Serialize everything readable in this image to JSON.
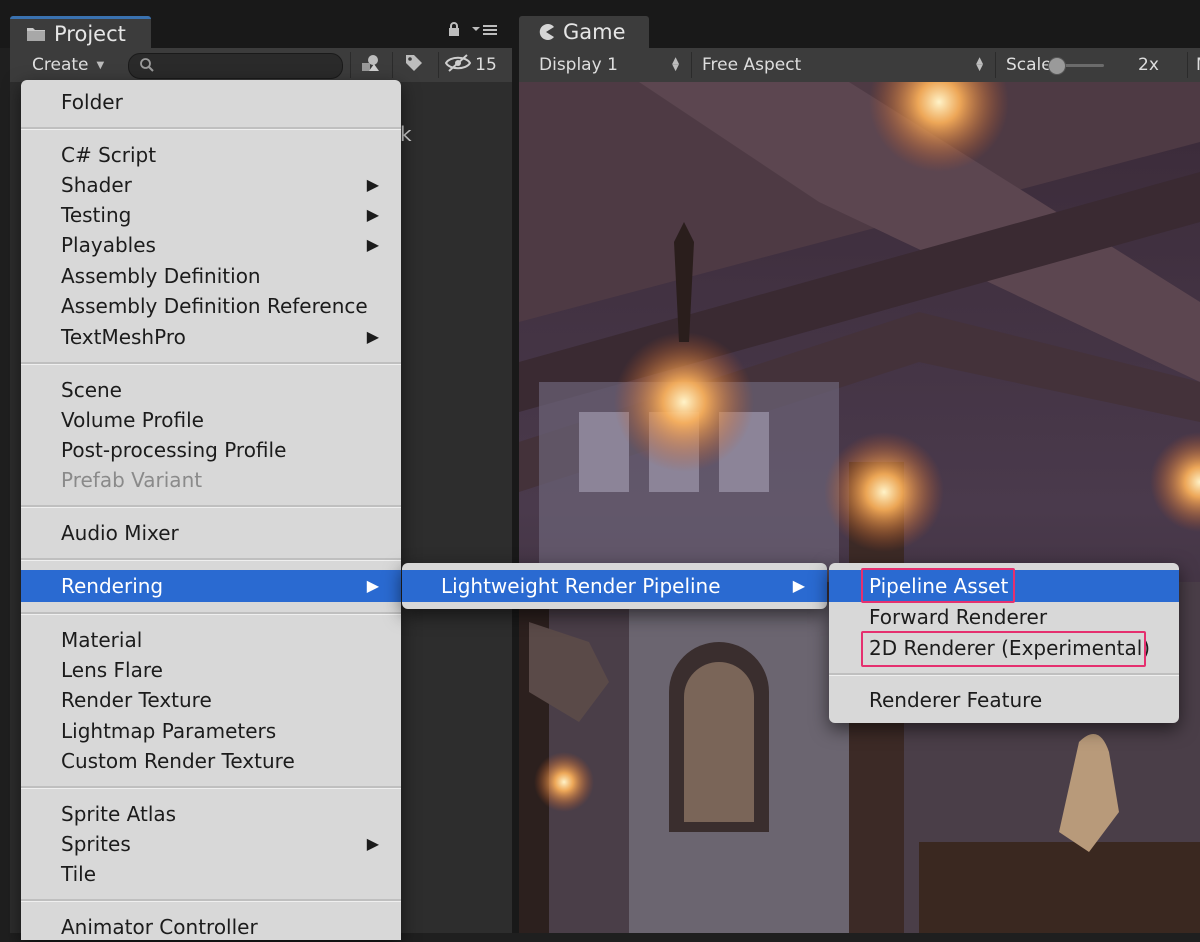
{
  "tabs": {
    "project": "Project",
    "game": "Game"
  },
  "project_toolbar": {
    "create_label": "Create",
    "search_placeholder": "",
    "hidden_count": "15"
  },
  "project_body": {
    "stray_text": "k"
  },
  "game_toolbar": {
    "display": "Display 1",
    "aspect": "Free Aspect",
    "scale_label": "Scale",
    "scale_value": "2x",
    "cut_label": "M"
  },
  "menu_main": {
    "items": [
      {
        "label": "Folder"
      },
      {
        "label": "C# Script"
      },
      {
        "label": "Shader",
        "submenu": true
      },
      {
        "label": "Testing",
        "submenu": true
      },
      {
        "label": "Playables",
        "submenu": true
      },
      {
        "label": "Assembly Definition"
      },
      {
        "label": "Assembly Definition Reference"
      },
      {
        "label": "TextMeshPro",
        "submenu": true
      },
      {
        "label": "Scene"
      },
      {
        "label": "Volume Profile"
      },
      {
        "label": "Post-processing Profile"
      },
      {
        "label": "Prefab Variant",
        "disabled": true
      },
      {
        "label": "Audio Mixer"
      },
      {
        "label": "Rendering",
        "submenu": true,
        "highlighted": true
      },
      {
        "label": "Material"
      },
      {
        "label": "Lens Flare"
      },
      {
        "label": "Render Texture"
      },
      {
        "label": "Lightmap Parameters"
      },
      {
        "label": "Custom Render Texture"
      },
      {
        "label": "Sprite Atlas"
      },
      {
        "label": "Sprites",
        "submenu": true
      },
      {
        "label": "Tile"
      },
      {
        "label": "Animator Controller"
      }
    ]
  },
  "menu_rendering": {
    "items": [
      {
        "label": "Lightweight Render Pipeline",
        "submenu": true,
        "highlighted": true
      }
    ]
  },
  "menu_lrp": {
    "items": [
      {
        "label": "Pipeline Asset",
        "highlighted": true,
        "outlined": true
      },
      {
        "label": "Forward Renderer"
      },
      {
        "label": "2D Renderer (Experimental)",
        "outlined": true
      },
      {
        "label": "Renderer Feature"
      }
    ]
  },
  "colors": {
    "highlight": "#2a6ad1",
    "annotation_outline": "#e5306f",
    "menu_bg": "#d8d8d8",
    "panel_bg": "#3c3c3c"
  },
  "icons": {
    "project_tab": "folder-icon",
    "game_tab": "pacman-icon",
    "submenu": "triangle-right-icon"
  }
}
